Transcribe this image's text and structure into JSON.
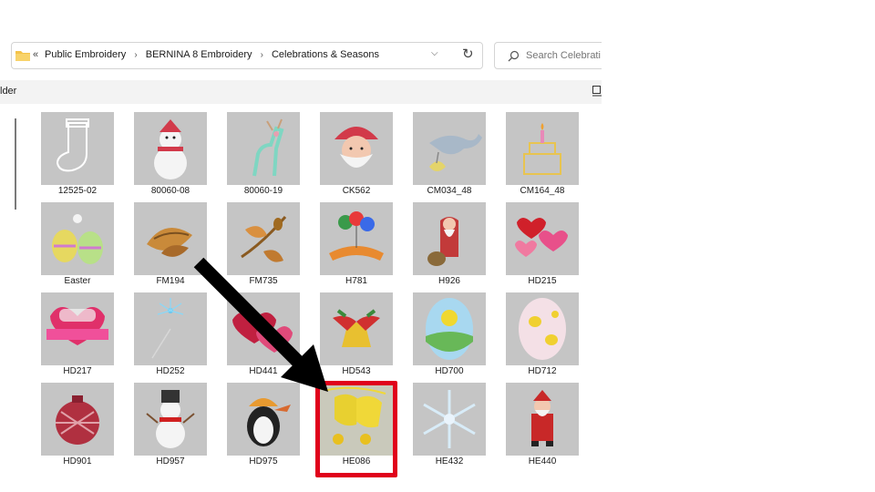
{
  "address": {
    "crumbs": [
      "Public Embroidery",
      "BERNINA 8 Embroidery",
      "Celebrations & Seasons"
    ],
    "overflow_glyph": "«",
    "dropdown_glyph": "⌵",
    "refresh_glyph": "↻"
  },
  "search": {
    "placeholder": "Search Celebrati"
  },
  "cmdbar": {
    "label": "lder"
  },
  "files": [
    {
      "name": "12525-02",
      "art": "stocking"
    },
    {
      "name": "80060-08",
      "art": "snowman"
    },
    {
      "name": "80060-19",
      "art": "deer"
    },
    {
      "name": "CK562",
      "art": "santa-face"
    },
    {
      "name": "CM034_48",
      "art": "stork"
    },
    {
      "name": "CM164_48",
      "art": "cake"
    },
    {
      "name": "Easter",
      "art": "easter-eggs"
    },
    {
      "name": "FM194",
      "art": "leaves"
    },
    {
      "name": "FM735",
      "art": "leaves-acorn"
    },
    {
      "name": "H781",
      "art": "balloons-banner"
    },
    {
      "name": "H926",
      "art": "santa-sack"
    },
    {
      "name": "HD215",
      "art": "heart-balloons"
    },
    {
      "name": "HD217",
      "art": "valentine"
    },
    {
      "name": "HD252",
      "art": "firework"
    },
    {
      "name": "HD441",
      "art": "hearts"
    },
    {
      "name": "HD543",
      "art": "bells"
    },
    {
      "name": "HD700",
      "art": "sun-egg"
    },
    {
      "name": "HD712",
      "art": "chick-egg"
    },
    {
      "name": "HD901",
      "art": "ornament"
    },
    {
      "name": "HD957",
      "art": "snowman-scarf"
    },
    {
      "name": "HD975",
      "art": "penguin"
    },
    {
      "name": "HE086",
      "art": "gold-bells"
    },
    {
      "name": "HE432",
      "art": "snowflake"
    },
    {
      "name": "HE440",
      "art": "santa-standing"
    }
  ],
  "annotations": {
    "highlight_color": "#e0001b",
    "arrow_color": "#000000",
    "highlighted_file": "HE086"
  },
  "colors": {
    "thumb_bg": "#c5c5c5",
    "folder": "#f4c34a"
  }
}
